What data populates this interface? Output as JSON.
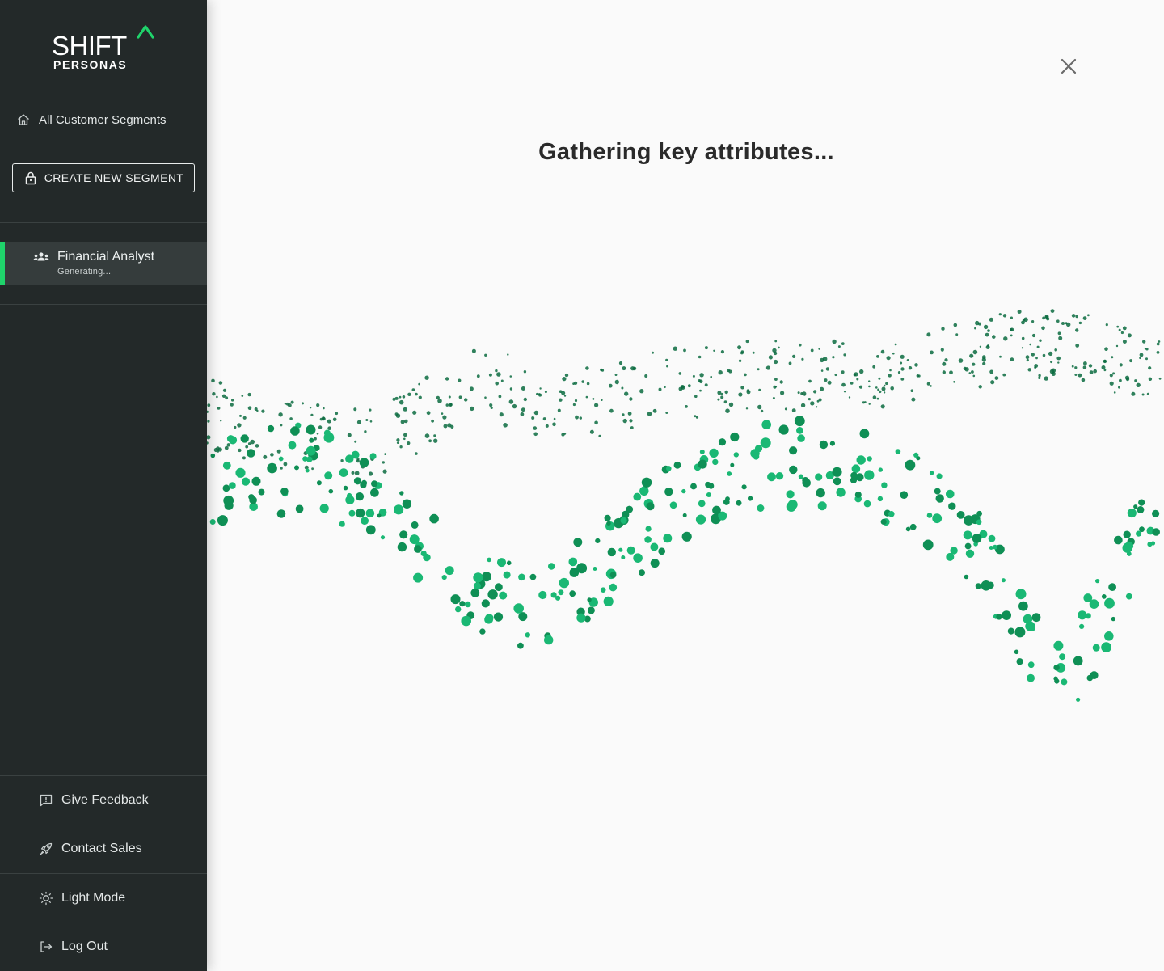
{
  "brand": {
    "name": "SHIFT",
    "subname": "PERSONAS",
    "accent_color": "#1fd36b"
  },
  "sidebar": {
    "home_link": {
      "label": "All Customer Segments",
      "icon": "home-icon"
    },
    "create_button": {
      "label": "CREATE NEW SEGMENT",
      "icon": "lock-icon"
    },
    "segments": [
      {
        "name": "Financial Analyst",
        "status": "Generating...",
        "icon": "people-icon",
        "active": true
      }
    ],
    "bottom": {
      "feedback": {
        "label": "Give Feedback",
        "icon": "feedback-icon"
      },
      "sales": {
        "label": "Contact Sales",
        "icon": "rocket-icon"
      },
      "theme": {
        "label": "Light Mode",
        "icon": "sun-icon"
      },
      "logout": {
        "label": "Log Out",
        "icon": "logout-icon"
      }
    }
  },
  "main": {
    "loading_title": "Gathering key attributes...",
    "close_icon": "close-icon",
    "visual": {
      "type": "particle-wave",
      "colors": [
        "#1ab874",
        "#0f8f55",
        "#0b6b3f"
      ]
    }
  }
}
